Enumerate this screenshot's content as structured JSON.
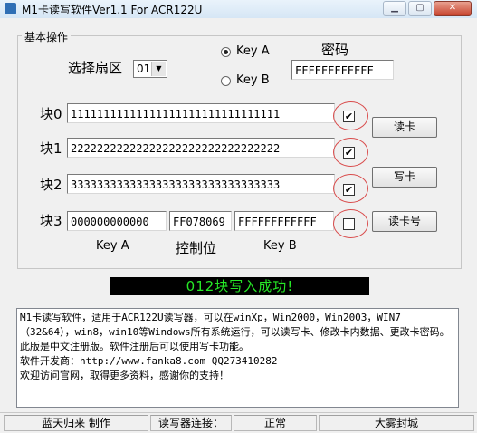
{
  "window": {
    "title": "M1卡读写软件Ver1.1 For ACR122U"
  },
  "group": {
    "title": "基本操作"
  },
  "sector": {
    "label": "选择扇区",
    "value": "01"
  },
  "key": {
    "option_a": "Key A",
    "option_b": "Key B",
    "selected": "Key A",
    "password_label": "密码",
    "password": "FFFFFFFFFFFF"
  },
  "blocks": [
    {
      "label": "块0",
      "data": "11111111111111111111111111111111",
      "checked": true
    },
    {
      "label": "块1",
      "data": "22222222222222222222222222222222",
      "checked": true
    },
    {
      "label": "块2",
      "data": "33333333333333333333333333333333",
      "checked": true
    },
    {
      "label": "块3",
      "key_a": "000000000000",
      "control": "FF078069",
      "key_b": "FFFFFFFFFFFF",
      "checked": false
    }
  ],
  "block3_labels": {
    "key_a": "Key A",
    "control": "控制位",
    "key_b": "Key B"
  },
  "buttons": {
    "read": "读卡",
    "write": "写卡",
    "read_id": "读卡号"
  },
  "status": {
    "message": "012块写入成功!",
    "color": "#26e826"
  },
  "info": {
    "lines": [
      "M1卡读写软件，适用于ACR122U读写器，可以在winXp，Win2000，Win2003，WIN7（32&64），win8，win10等Windows所有系统运行，可以读写卡、修改卡内数据、更改卡密码。此版是中文注册版。软件注册后可以使用写卡功能。",
      "软件开发商：http://www.fanka8.com QQ273410282",
      "欢迎访问官网，取得更多资料，感谢你的支持！"
    ]
  },
  "statusbar": {
    "author": "蓝天归来 制作",
    "reader_label": "读写器连接：",
    "reader_state": "正常",
    "right": "大雾封城"
  },
  "icons": {
    "check": "✔",
    "minimize": "minimize-icon",
    "maximize": "maximize-icon",
    "close": "close-icon"
  }
}
